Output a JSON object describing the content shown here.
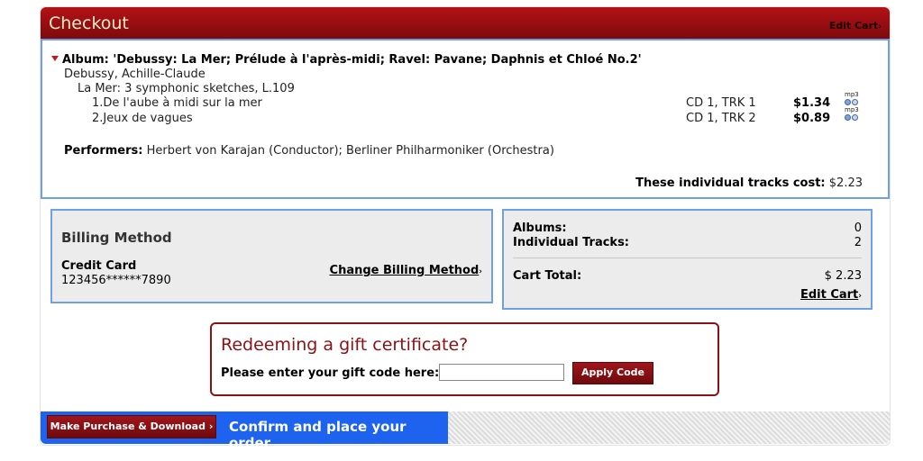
{
  "header": {
    "title": "Checkout",
    "edit_cart": "Edit Cart"
  },
  "album": {
    "title": "Album: 'Debussy: La Mer; Prélude à l'après-midi; Ravel: Pavane; Daphnis et Chloé No.2'",
    "composer": "Debussy, Achille-Claude",
    "work": "La Mer: 3 symphonic sketches, L.109",
    "tracks": [
      {
        "name": "1.De l'aube à midi sur la mer",
        "position": "CD 1, TRK 1",
        "price": "$1.34",
        "format": "mp3"
      },
      {
        "name": "2.Jeux de vagues",
        "position": "CD 1, TRK 2",
        "price": "$0.89",
        "format": "mp3"
      }
    ],
    "performers_label": "Performers:",
    "performers_value": "Herbert von Karajan (Conductor); Berliner Philharmoniker (Orchestra)",
    "cost_label": "These individual tracks cost:",
    "cost_value": "$2.23"
  },
  "billing": {
    "heading": "Billing Method",
    "method": "Credit Card",
    "card_number": "123456******7890",
    "change_link": "Change Billing Method"
  },
  "summary": {
    "albums_label": "Albums:",
    "albums_value": "0",
    "tracks_label": "Individual Tracks:",
    "tracks_value": "2",
    "total_label": "Cart Total:",
    "total_value": "$ 2.23",
    "edit_cart": "Edit Cart"
  },
  "gift": {
    "title": "Redeeming a gift certificate?",
    "prompt": "Please enter your gift code here:",
    "input_value": "",
    "apply_label": "Apply Code"
  },
  "footer": {
    "purchase_label": "Make Purchase & Download",
    "confirm_text": "Confirm and place your order"
  },
  "colors": {
    "brand_red": "#8c1014",
    "accent_blue": "#1e63f0",
    "border_blue": "#6f9fe6"
  },
  "icons": {
    "expand": "triangle-down-icon",
    "arrow": "chevron-right-icon",
    "format": "mp3-icon"
  }
}
